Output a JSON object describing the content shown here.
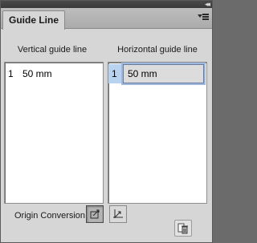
{
  "panel": {
    "tab_label": "Guide Line"
  },
  "vertical": {
    "header": "Vertical guide line",
    "rows": [
      {
        "index": "1",
        "value": "50 mm"
      }
    ]
  },
  "horizontal": {
    "header": "Horizontal guide line",
    "rows": [
      {
        "index": "1",
        "value": "50 mm",
        "selected": true,
        "editing": true
      }
    ]
  },
  "origin": {
    "label": "Origin Conversion",
    "buttons": [
      {
        "icon": "origin-top-left-icon",
        "pressed": true
      },
      {
        "icon": "origin-bottom-left-icon",
        "pressed": false
      }
    ]
  },
  "footer": {
    "delete_icon": "delete-guide-icon"
  },
  "colors": {
    "panel_bg": "#d6d6d6",
    "selection": "#b8d2f0",
    "focus_ring": "#9fb8df"
  }
}
